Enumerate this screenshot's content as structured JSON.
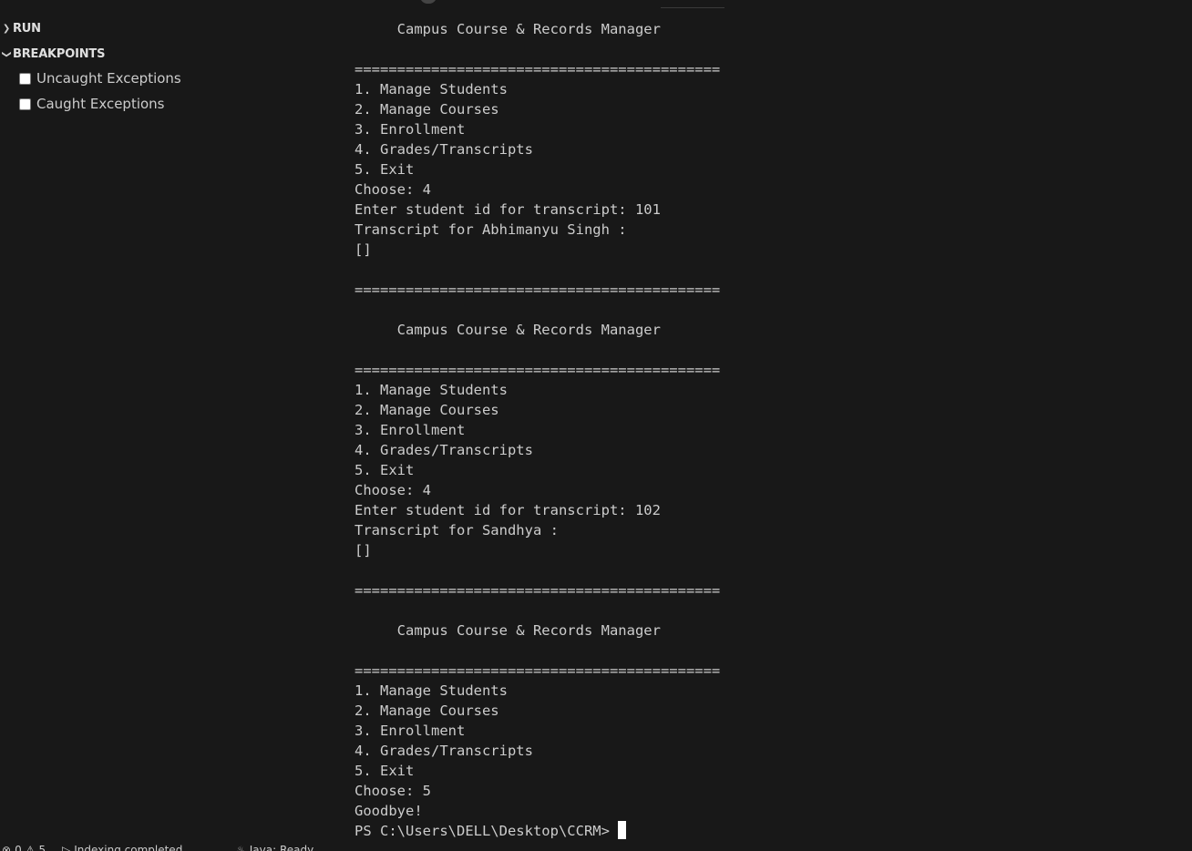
{
  "sidebar": {
    "run_label": "RUN",
    "breakpoints_label": "BREAKPOINTS",
    "breakpoints": [
      {
        "label": "Uncaught Exceptions",
        "checked": false
      },
      {
        "label": "Caught Exceptions",
        "checked": false
      }
    ]
  },
  "terminal": {
    "lines": [
      "     Campus Course & Records Manager",
      "",
      "===========================================",
      "1. Manage Students",
      "2. Manage Courses",
      "3. Enrollment",
      "4. Grades/Transcripts",
      "5. Exit",
      "Choose: 4",
      "Enter student id for transcript: 101",
      "Transcript for Abhimanyu Singh :",
      "[]",
      "",
      "===========================================",
      "",
      "     Campus Course & Records Manager",
      "",
      "===========================================",
      "1. Manage Students",
      "2. Manage Courses",
      "3. Enrollment",
      "4. Grades/Transcripts",
      "5. Exit",
      "Choose: 4",
      "Enter student id for transcript: 102",
      "Transcript for Sandhya :",
      "[]",
      "",
      "===========================================",
      "",
      "     Campus Course & Records Manager",
      "",
      "===========================================",
      "1. Manage Students",
      "2. Manage Courses",
      "3. Enrollment",
      "4. Grades/Transcripts",
      "5. Exit",
      "Choose: 5",
      "Goodbye!"
    ],
    "prompt": "PS C:\\Users\\DELL\\Desktop\\CCRM>"
  },
  "statusbar": {
    "errors": "0",
    "warnings": "5",
    "indexing": "Indexing completed.",
    "java": "Java: Ready"
  }
}
